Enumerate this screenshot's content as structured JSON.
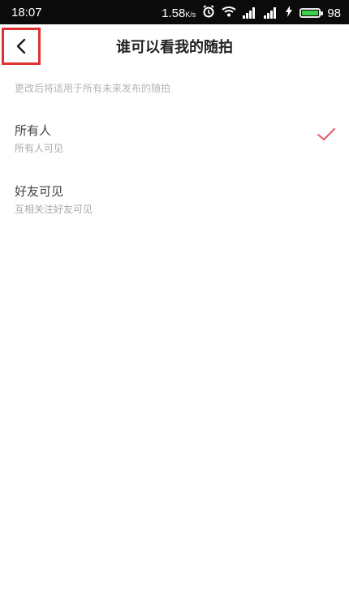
{
  "status_bar": {
    "time": "18:07",
    "network_speed": "1.58",
    "network_unit": "K/s",
    "battery_level": "98",
    "icons": [
      "alarm-icon",
      "wifi-icon",
      "signal-icon",
      "signal-icon",
      "charging-icon",
      "battery-icon"
    ]
  },
  "header": {
    "title": "谁可以看我的随拍",
    "back_icon": "chevron-left-icon"
  },
  "hint": "更改后将适用于所有未来发布的随拍",
  "options": [
    {
      "label": "所有人",
      "desc": "所有人可见",
      "selected": true
    },
    {
      "label": "好友可见",
      "desc": "互相关注好友可见",
      "selected": false
    }
  ],
  "colors": {
    "accent_check": "#e2566c",
    "highlight_box": "#e03131"
  }
}
